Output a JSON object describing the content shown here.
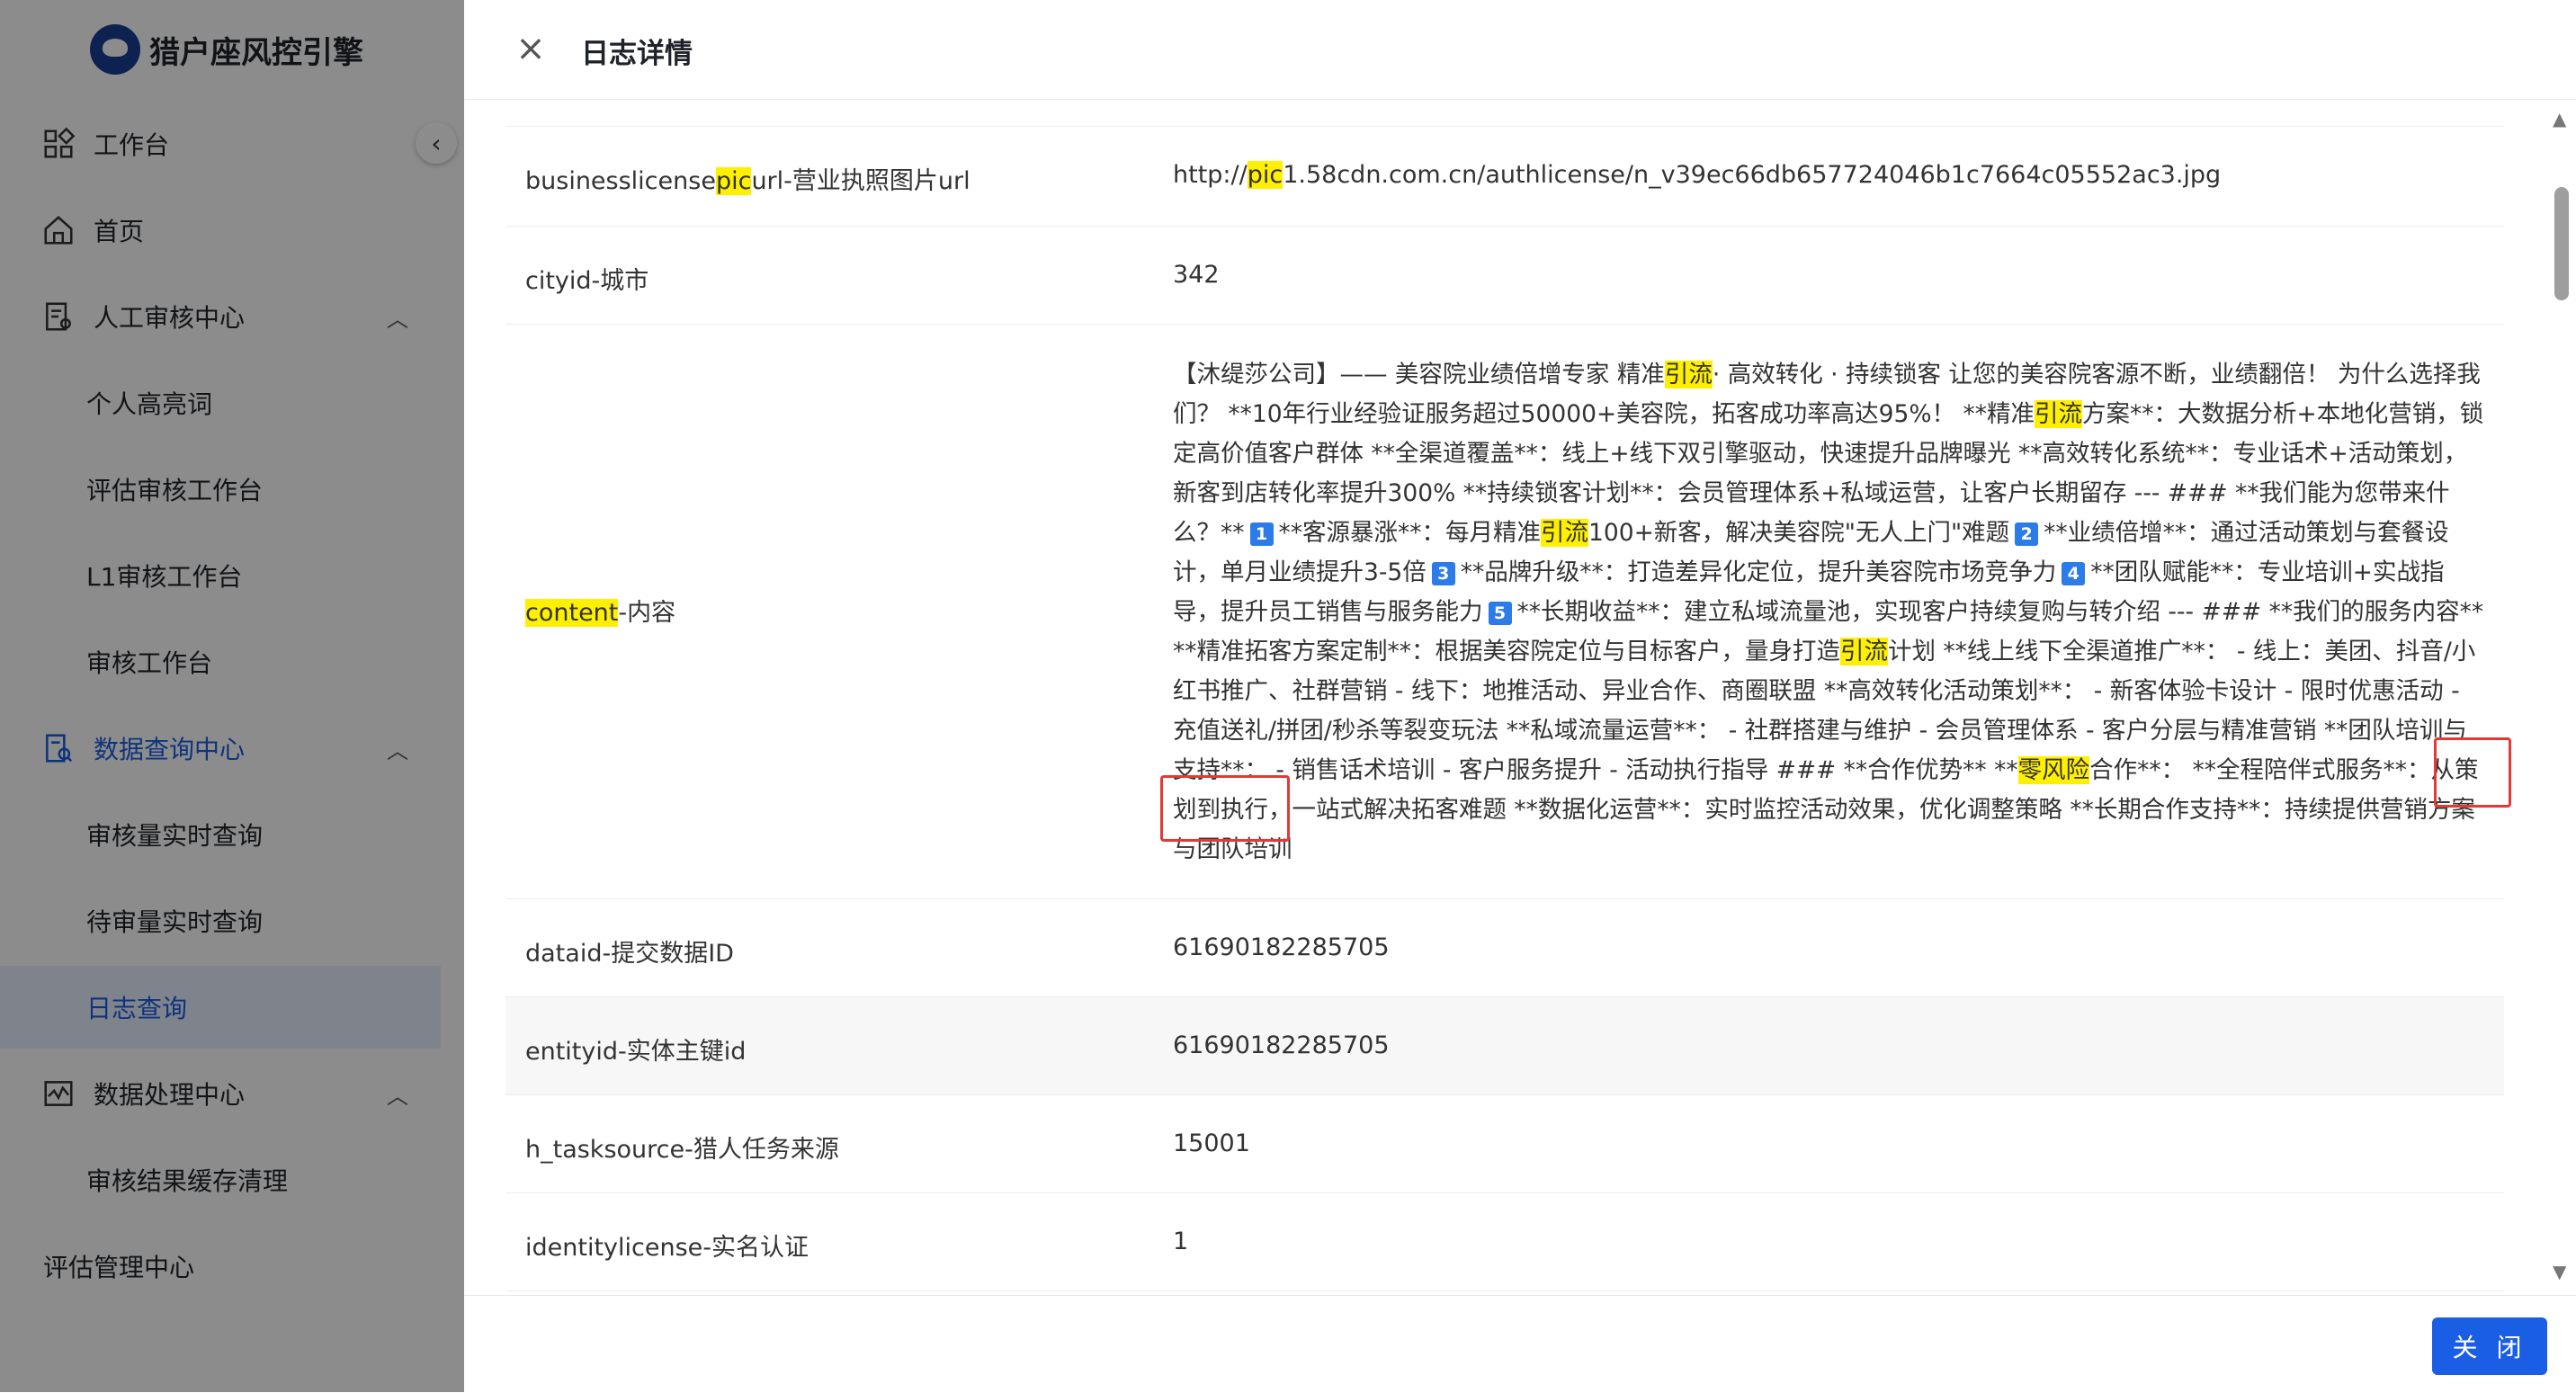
{
  "app": {
    "title": "猎户座风控引擎"
  },
  "sidebar": {
    "items": [
      {
        "label": "工作台",
        "icon": "dashboard-icon"
      },
      {
        "label": "首页",
        "icon": "home-icon"
      },
      {
        "label": "人工审核中心",
        "icon": "review-icon"
      },
      {
        "label": "个人高亮词"
      },
      {
        "label": "评估审核工作台"
      },
      {
        "label": "L1审核工作台"
      },
      {
        "label": "审核工作台"
      },
      {
        "label": "数据查询中心",
        "icon": "data-query-icon"
      },
      {
        "label": "审核量实时查询"
      },
      {
        "label": "待审量实时查询"
      },
      {
        "label": "日志查询"
      },
      {
        "label": "数据处理中心",
        "icon": "data-process-icon"
      },
      {
        "label": "审核结果缓存清理"
      },
      {
        "label": "评估管理中心"
      }
    ]
  },
  "drawer": {
    "title": "日志详情",
    "close_label": "关 闭",
    "rows": [
      {
        "key_pre": "businesslicense",
        "key_hl": "pic",
        "key_post": "url-营业执照图片url",
        "val_pre": "http://",
        "val_hl": "pic",
        "val_post": "1.58cdn.com.cn/authlicense/n_v39ec66db657724046b1c7664c05552ac3.jpg"
      },
      {
        "key": "cityid-城市",
        "value": "342"
      },
      {
        "key_hl": "content",
        "key_post": "-内容"
      },
      {
        "key": "dataid-提交数据ID",
        "value": "61690182285705"
      },
      {
        "key": "entityid-实体主键id",
        "value": "61690182285705"
      },
      {
        "key": "h_tasksource-猎人任务来源",
        "value": "15001"
      },
      {
        "key": "identitylicense-实名认证",
        "value": "1"
      }
    ],
    "content": {
      "p1": "【沐缇莎公司】—— 美容院业绩倍增专家 精准",
      "h1": "引流",
      "p2": "· 高效转化 · 持续锁客 让您的美容院客源不断，业绩翻倍！ 为什么选择我们？ **10年行业经验证服务超过50000+美容院，拓客成功率高达95%！ **精准",
      "h2": "引流",
      "p3": "方案**：大数据分析+本地化营销，锁定高价值客户群体 **全渠道覆盖**：线上+线下双引擎驱动，快速提升品牌曝光 **高效转化系统**：专业话术+活动策划，新客到店转化率提升300% **持续锁客计划**：会员管理体系+私域运营，让客户长期留存 --- ### **我们能为您带来什么？**",
      "b1": "1",
      "p4": "**客源暴涨**：每月精准",
      "h3": "引流",
      "p5": "100+新客，解决美容院\"无人上门\"难题",
      "b2": "2",
      "p6": "**业绩倍增**：通过活动策划与套餐设计，单月业绩提升3-5倍",
      "b3": "3",
      "p7": "**品牌升级**：打造差异化定位，提升美容院市场竞争力",
      "b4": "4",
      "p8": "**团队赋能**：专业培训+实战指导，提升员工销售与服务能力",
      "b5": "5",
      "p9": "**长期收益**：建立私域流量池，实现客户持续复购与转介绍 --- ### **我们的服务内容** **精准拓客方案定制**：根据美容院定位与目标客户，量身打造",
      "h4": "引流",
      "p10": "计划 **线上线下全渠道推广**： - 线上：美团、抖音/小红书推广、社群营销 - 线下：地推活动、异业合作、商圈联盟 **高效转化活动策划**： - 新客体验卡设计 - 限时优惠活动 - 充值送礼/拼团/秒杀等裂变玩法 **私域流量运营**： - 社群搭建与维护 - 会员管理体系 - 客户分层与精准营销 **团队培训与支持**： - 销售话术培训 - 客户服务提升 - 活动执行指导 ### **合作优势** **",
      "h5": "零风险",
      "p11": "合作**： **全程陪伴式服务**：从策划到执行，一站式解决拓客难题 **数据化运营**：实时监控活动效果，优化调整策略 **长期合作支持**：持续提供营销方案与团队培训"
    }
  }
}
